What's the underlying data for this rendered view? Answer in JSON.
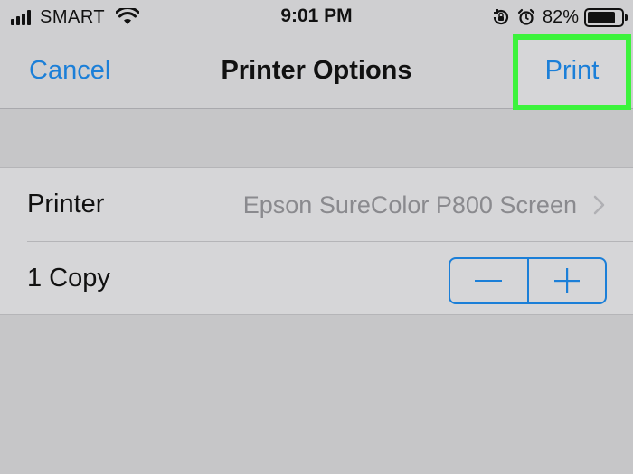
{
  "status_bar": {
    "carrier": "SMART",
    "time": "9:01 PM",
    "battery_percent": "82%",
    "battery_level": 0.82,
    "signal_bars": 4,
    "icons": [
      "signal-icon",
      "wifi-icon",
      "orientation-lock-icon",
      "alarm-icon",
      "battery-icon"
    ]
  },
  "nav": {
    "cancel_label": "Cancel",
    "title": "Printer Options",
    "print_label": "Print"
  },
  "options": {
    "printer": {
      "label": "Printer",
      "value": "Epson SureColor P800 Screen"
    },
    "copies": {
      "label": "1 Copy",
      "decrement_symbol": "−",
      "increment_symbol": "+"
    }
  },
  "colors": {
    "accent": "#1b7fd8",
    "highlight": "#3cf33c",
    "background": "#c6c6c8"
  }
}
